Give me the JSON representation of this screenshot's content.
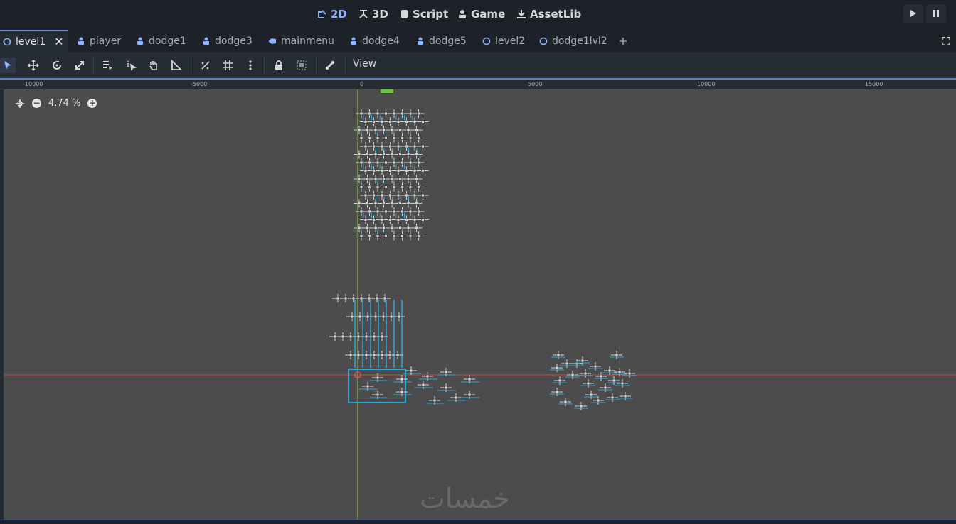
{
  "workspaces": [
    {
      "label": "2D",
      "icon": "2d-icon",
      "active": true
    },
    {
      "label": "3D",
      "icon": "3d-icon"
    },
    {
      "label": "Script",
      "icon": "script-icon"
    },
    {
      "label": "Game",
      "icon": "game-icon"
    },
    {
      "label": "AssetLib",
      "icon": "assetlib-icon"
    }
  ],
  "run_controls": [
    "play-icon",
    "pause-icon"
  ],
  "tabs": [
    {
      "label": "level1",
      "icon": "node2d-icon",
      "active": true,
      "close": "✕"
    },
    {
      "label": "player",
      "icon": "characterbody-icon"
    },
    {
      "label": "dodge1",
      "icon": "characterbody-icon"
    },
    {
      "label": "dodge3",
      "icon": "characterbody-icon"
    },
    {
      "label": "mainmenu",
      "icon": "control-icon"
    },
    {
      "label": "dodge4",
      "icon": "characterbody-icon"
    },
    {
      "label": "dodge5",
      "icon": "characterbody-icon"
    },
    {
      "label": "level2",
      "icon": "node2d-icon"
    },
    {
      "label": "dodge1lvl2",
      "icon": "node2d-icon"
    }
  ],
  "toolbar": {
    "view_label": "View",
    "tools": [
      "select-icon",
      "move-icon",
      "rotate-icon",
      "scale-icon",
      "list-select-icon",
      "pivot-icon",
      "pan-icon",
      "ruler-icon",
      "smart-snap-icon",
      "grid-snap-icon",
      "more-icon",
      "lock-icon",
      "group-icon",
      "bone-icon"
    ]
  },
  "viewport": {
    "zoom_label": "4.74 %",
    "ruler_labels": [
      "-10000",
      "-5000",
      "0",
      "5000",
      "10000",
      "15000"
    ]
  },
  "watermark": "خمسات",
  "colors": {
    "accent": "#8cb3ff",
    "canvas": "#4c4c4c",
    "x_axis": "#c8484a",
    "y_axis": "#8cc43c",
    "collision": "#2aa8d8"
  }
}
